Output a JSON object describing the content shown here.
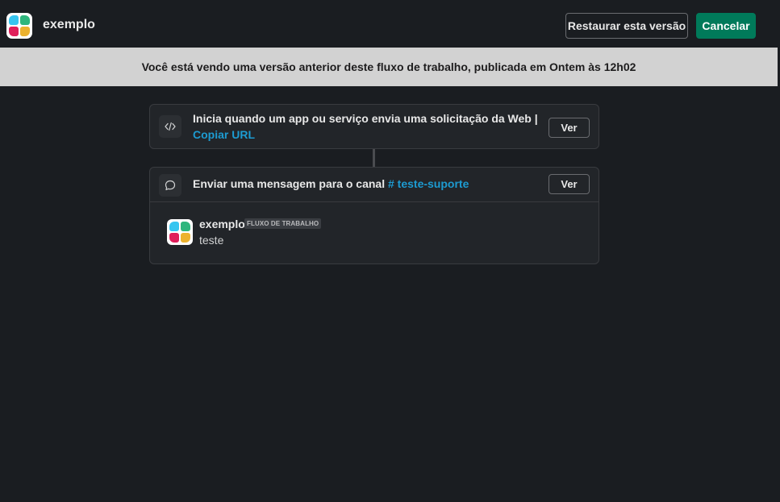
{
  "app": {
    "name": "exemplo",
    "logo_colors": [
      "#36c5f0",
      "#2eb67d",
      "#e01e5a",
      "#ecb22e"
    ]
  },
  "toolbar": {
    "restore_label": "Restaurar esta versão",
    "cancel_label": "Cancelar",
    "accent_color": "#007a5a"
  },
  "banner": {
    "text": "Você está vendo uma versão anterior deste fluxo de trabalho, publicada em Ontem às 12h02"
  },
  "steps": [
    {
      "icon": "code-icon",
      "text": "Inicia quando um app ou serviço envia uma solicitação da Web |",
      "link": "Copiar URL",
      "button": "Ver"
    },
    {
      "icon": "message-bubble-icon",
      "text": "Enviar uma mensagem para o canal",
      "channel": "# teste-suporte",
      "button": "Ver",
      "message": {
        "author": "exemplo",
        "badge": "FLUXO DE TRABALHO",
        "body": "teste"
      }
    }
  ]
}
